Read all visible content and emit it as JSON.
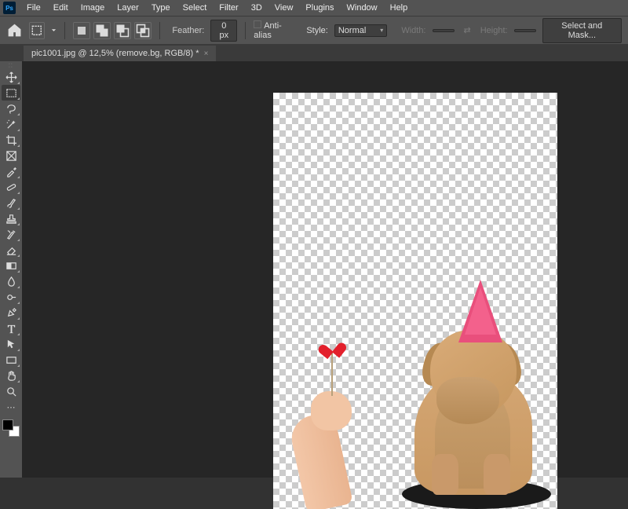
{
  "menu": [
    "File",
    "Edit",
    "Image",
    "Layer",
    "Type",
    "Select",
    "Filter",
    "3D",
    "View",
    "Plugins",
    "Window",
    "Help"
  ],
  "optionsBar": {
    "feather_label": "Feather:",
    "feather_value": "0 px",
    "antialias_label": "Anti-alias",
    "style_label": "Style:",
    "style_value": "Normal",
    "width_label": "Width:",
    "height_label": "Height:",
    "mask_btn": "Select and Mask..."
  },
  "tab": {
    "title": "pic1001.jpg @ 12,5% (remove.bg, RGB/8) *",
    "close": "×"
  },
  "tools": [
    "move-tool",
    "rectangular-marquee-tool",
    "lasso-tool",
    "quick-selection-tool",
    "crop-tool",
    "frame-tool",
    "eyedropper-tool",
    "spot-healing-brush-tool",
    "brush-tool",
    "clone-stamp-tool",
    "history-brush-tool",
    "eraser-tool",
    "gradient-tool",
    "blur-tool",
    "dodge-tool",
    "pen-tool",
    "type-tool",
    "path-selection-tool",
    "rectangle-tool",
    "hand-tool",
    "zoom-tool"
  ],
  "canvas": {
    "subject": "dog with party hat, hand holding heart lollipop, transparent background"
  }
}
